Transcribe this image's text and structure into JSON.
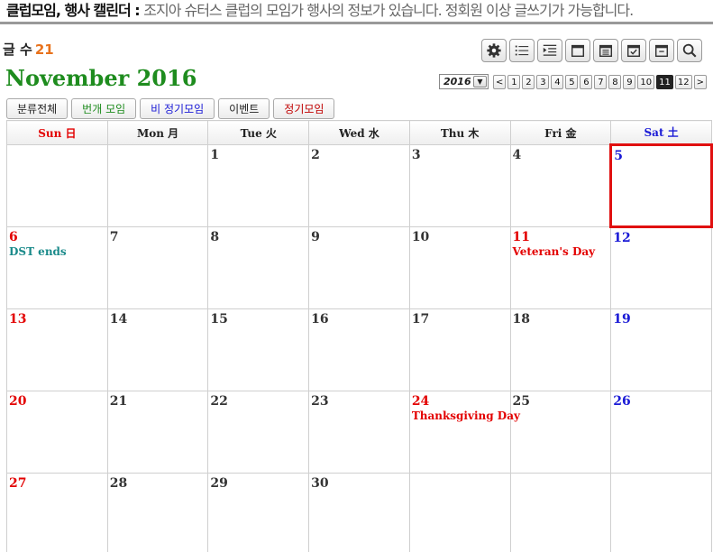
{
  "header": {
    "title": "클럽모임, 행사 캘린더 : ",
    "description": "조지아 슈터스 클럽의 모임가 행사의 정보가 있습니다. 정회원 이상 글쓰기가 가능합니다."
  },
  "post_count": {
    "label": "글 수",
    "value": "21"
  },
  "month_title": "November 2016",
  "year_select": {
    "value": "2016"
  },
  "month_nav": [
    "<",
    "1",
    "2",
    "3",
    "4",
    "5",
    "6",
    "7",
    "8",
    "9",
    "10",
    "11",
    "12",
    ">"
  ],
  "active_month": "11",
  "categories": [
    {
      "label": "분류전체",
      "color": "#222222"
    },
    {
      "label": "번개 모임",
      "color": "#1e8c1e"
    },
    {
      "label": "비 정기모임",
      "color": "#1a1ad6"
    },
    {
      "label": "이벤트",
      "color": "#222222"
    },
    {
      "label": "정기모임",
      "color": "#c00000"
    }
  ],
  "weekdays": [
    {
      "label": "Sun 日",
      "type": "sun"
    },
    {
      "label": "Mon 月",
      "type": ""
    },
    {
      "label": "Tue 火",
      "type": ""
    },
    {
      "label": "Wed 水",
      "type": ""
    },
    {
      "label": "Thu 木",
      "type": ""
    },
    {
      "label": "Fri 金",
      "type": ""
    },
    {
      "label": "Sat 土",
      "type": "sat"
    }
  ],
  "weeks": [
    [
      {
        "day": ""
      },
      {
        "day": ""
      },
      {
        "day": "1"
      },
      {
        "day": "2"
      },
      {
        "day": "3"
      },
      {
        "day": "4"
      },
      {
        "day": "5",
        "type": "sat",
        "today": true
      }
    ],
    [
      {
        "day": "6",
        "type": "sun",
        "event": "DST ends",
        "event_color": "#1a8a8a"
      },
      {
        "day": "7"
      },
      {
        "day": "8"
      },
      {
        "day": "9"
      },
      {
        "day": "10"
      },
      {
        "day": "11",
        "type": "hol",
        "event": "Veteran's Day",
        "event_color": "#e30000"
      },
      {
        "day": "12",
        "type": "sat"
      }
    ],
    [
      {
        "day": "13",
        "type": "sun"
      },
      {
        "day": "14"
      },
      {
        "day": "15"
      },
      {
        "day": "16"
      },
      {
        "day": "17"
      },
      {
        "day": "18"
      },
      {
        "day": "19",
        "type": "sat"
      }
    ],
    [
      {
        "day": "20",
        "type": "sun"
      },
      {
        "day": "21"
      },
      {
        "day": "22"
      },
      {
        "day": "23"
      },
      {
        "day": "24",
        "type": "hol",
        "event": "Thanksgiving Day",
        "event_color": "#e30000"
      },
      {
        "day": "25"
      },
      {
        "day": "26",
        "type": "sat"
      }
    ],
    [
      {
        "day": "27",
        "type": "sun"
      },
      {
        "day": "28"
      },
      {
        "day": "29"
      },
      {
        "day": "30"
      },
      {
        "day": ""
      },
      {
        "day": ""
      },
      {
        "day": ""
      }
    ]
  ],
  "toolbar_icons": [
    "gear-icon",
    "list-icon",
    "indent-list-icon",
    "calendar-month-icon",
    "calendar-list-icon",
    "calendar-check-icon",
    "calendar-day-icon",
    "search-icon"
  ]
}
